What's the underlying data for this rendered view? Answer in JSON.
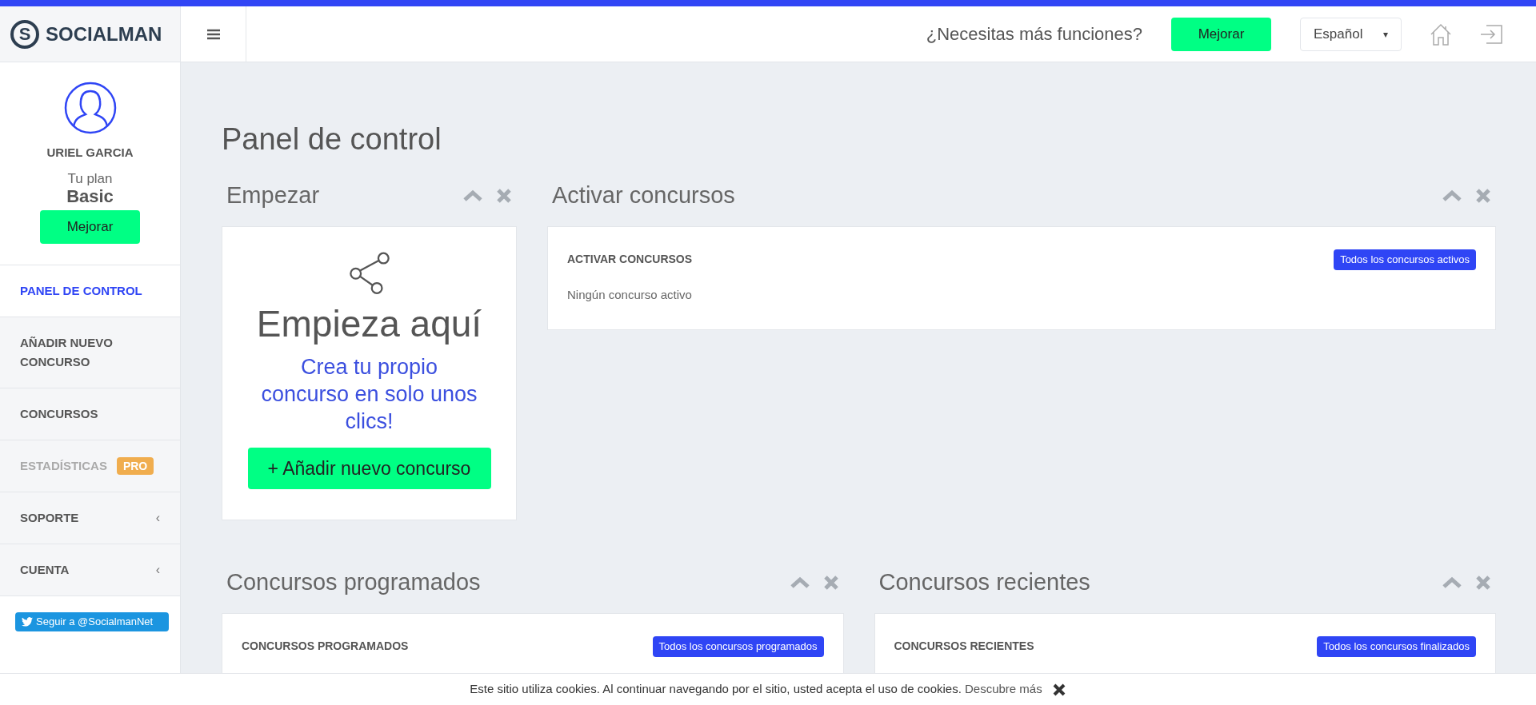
{
  "brand": {
    "logo_letter": "S",
    "name": "SOCIALMAN"
  },
  "topbar": {
    "prompt": "¿Necesitas más funciones?",
    "upgrade_button": "Mejorar",
    "language": {
      "value": "Español",
      "arrow": "▾"
    }
  },
  "profile": {
    "name": "URIEL GARCIA",
    "plan_label": "Tu plan",
    "plan": "Basic",
    "upgrade_button": "Mejorar"
  },
  "nav": [
    {
      "label": "PANEL DE CONTROL",
      "selected": true,
      "disabled": false
    },
    {
      "label": "AÑADIR NUEVO CONCURSO",
      "selected": false,
      "disabled": false
    },
    {
      "label": "CONCURSOS",
      "selected": false,
      "disabled": false
    },
    {
      "label": "ESTADÍSTICAS",
      "selected": false,
      "disabled": true,
      "badge": "PRO"
    },
    {
      "label": "SOPORTE",
      "selected": false,
      "disabled": false,
      "arrow": "‹"
    },
    {
      "label": "CUENTA",
      "selected": false,
      "disabled": false,
      "arrow": "‹"
    }
  ],
  "twitter_button": "Seguir a @SocialmanNet",
  "page_title": "Panel de control",
  "start_panel": {
    "title": "Empezar",
    "heading": "Empieza aquí",
    "subtitle": "Crea tu propio concurso en solo unos clics!",
    "button": "+ Añadir nuevo concurso"
  },
  "panels": [
    {
      "title": "Activar concursos",
      "card_title": "ACTIVAR CONCURSOS",
      "link": "Todos los concursos activos",
      "empty": "Ningún concurso activo"
    },
    {
      "title": "Concursos programados",
      "card_title": "CONCURSOS PROGRAMADOS",
      "link": "Todos los concursos programados"
    },
    {
      "title": "Concursos recientes",
      "card_title": "CONCURSOS RECIENTES",
      "link": "Todos los concursos finalizados"
    }
  ],
  "cookie_bar": {
    "text": "Este sitio utiliza cookies. Al continuar navegando por el sitio, usted acepta el uso de cookies.",
    "link": "Descubre más"
  }
}
